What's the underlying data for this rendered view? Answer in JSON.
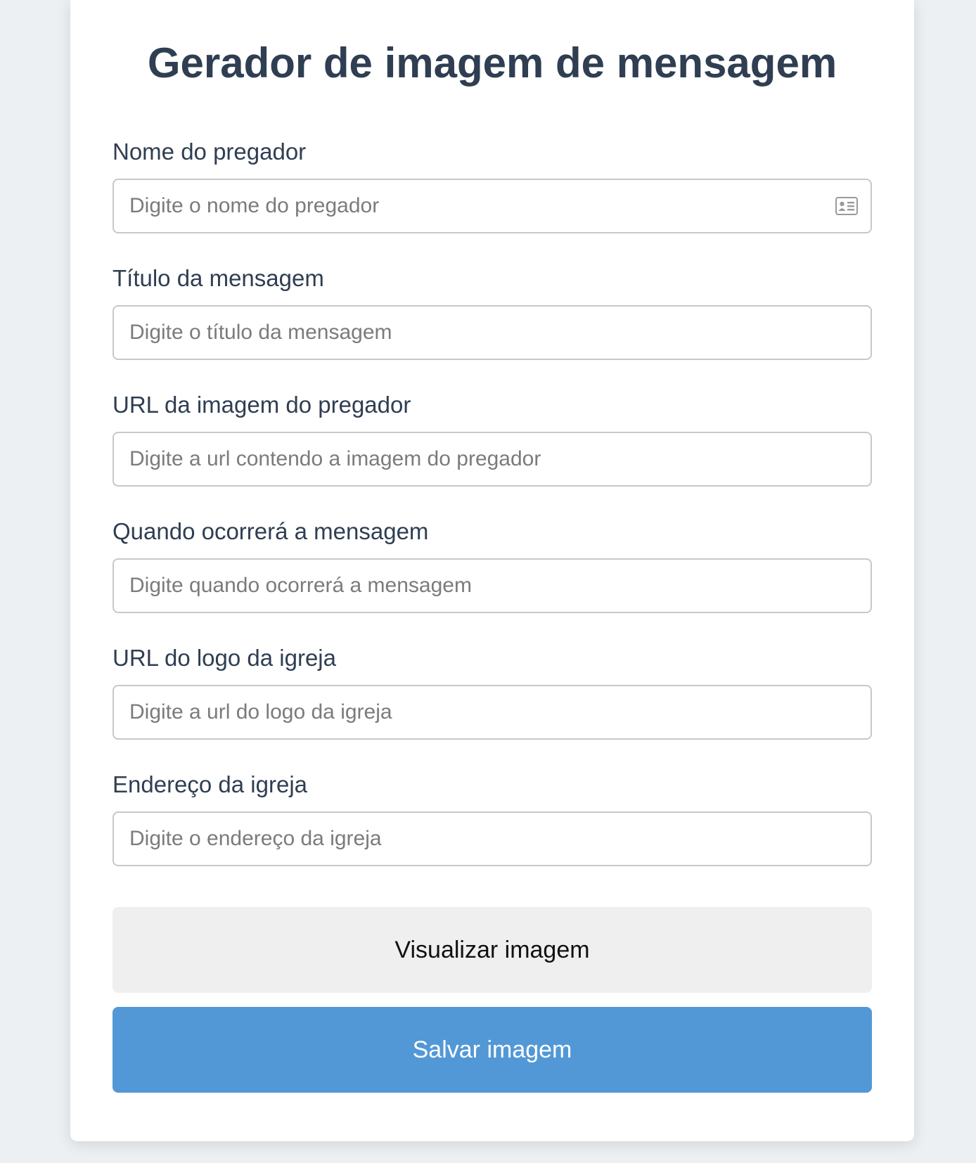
{
  "page": {
    "title": "Gerador de imagem de mensagem"
  },
  "form": {
    "fields": [
      {
        "label": "Nome do pregador",
        "placeholder": "Digite o nome do pregador",
        "icon": "contact-card-icon"
      },
      {
        "label": "Título da mensagem",
        "placeholder": "Digite o título da mensagem"
      },
      {
        "label": "URL da imagem do pregador",
        "placeholder": "Digite a url contendo a imagem do pregador"
      },
      {
        "label": "Quando ocorrerá a mensagem",
        "placeholder": "Digite quando ocorrerá a mensagem"
      },
      {
        "label": "URL do logo da igreja",
        "placeholder": "Digite a url do logo da igreja"
      },
      {
        "label": "Endereço da igreja",
        "placeholder": "Digite o endereço da igreja"
      }
    ]
  },
  "actions": {
    "preview_label": "Visualizar imagem",
    "save_label": "Salvar imagem"
  },
  "colors": {
    "background": "#edf0f2",
    "title": "#2f3e52",
    "primary_button": "#5298d6",
    "secondary_button": "#efefef"
  }
}
